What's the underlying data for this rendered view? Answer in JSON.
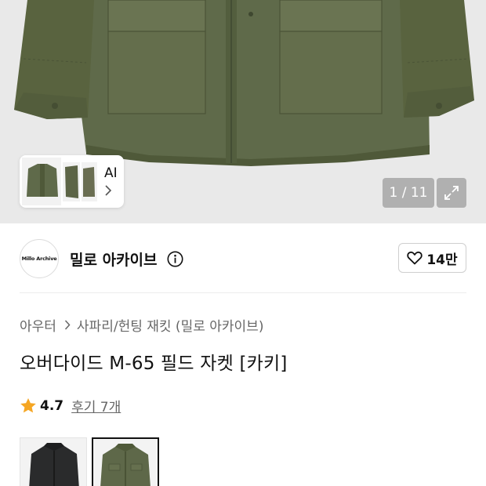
{
  "gallery": {
    "ai_label": "AI",
    "counter": "1 / 11",
    "icons": {
      "expand": "expand-icon",
      "chevron": "chevron-right-icon"
    }
  },
  "brand": {
    "logo_text": "Millo Archive",
    "name": "밀로 아카이브",
    "likes": "14만",
    "icons": {
      "info": "info-icon",
      "heart": "heart-icon"
    }
  },
  "breadcrumb": {
    "category": "아우터",
    "subcategory": "사파리/헌팅 재킷 (밀로 아카이브)"
  },
  "product": {
    "title": "오버다이드 M-65 필드 자켓 [카키]",
    "rating": "4.7",
    "reviews": "후기 7개"
  },
  "colors": {
    "star": "#f5a623",
    "jacket_khaki": "#5e6849",
    "jacket_black": "#2a2b2c",
    "option_selected_border": "#111111"
  },
  "options": [
    "black-jacket",
    "khaki-jacket"
  ]
}
